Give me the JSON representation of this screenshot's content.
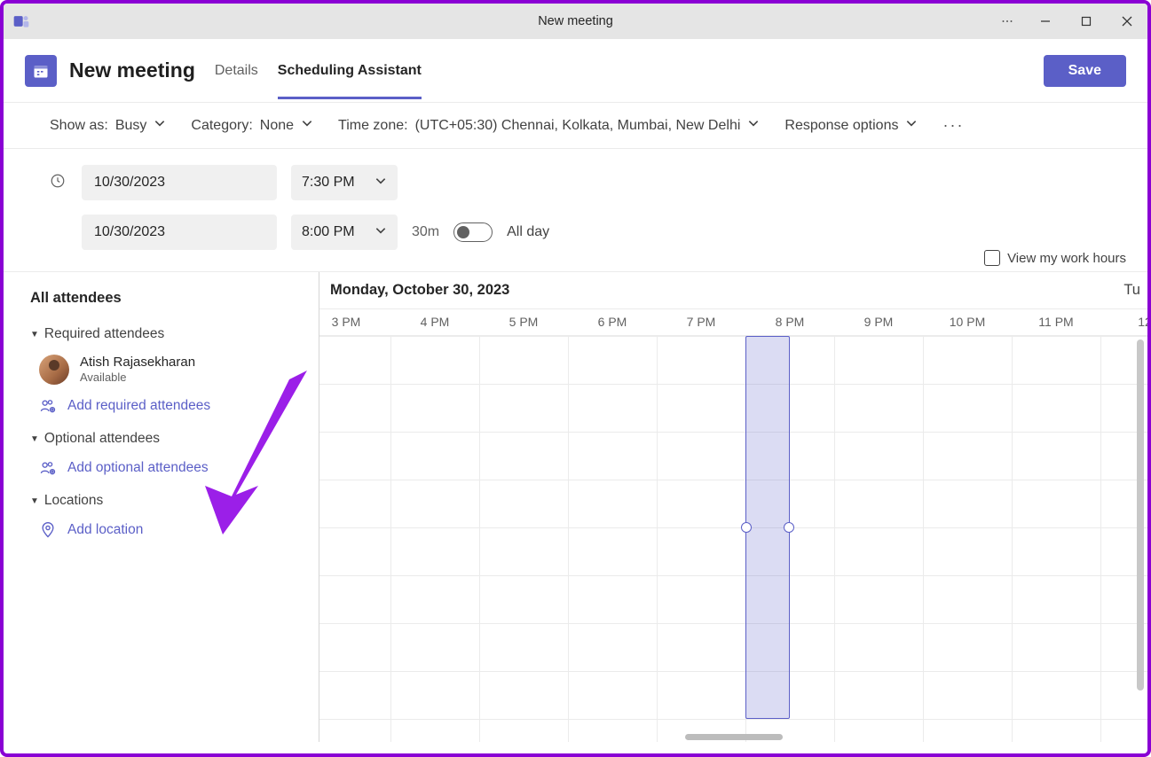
{
  "window": {
    "title": "New meeting"
  },
  "header": {
    "page_title": "New meeting",
    "tabs": {
      "details": "Details",
      "scheduling": "Scheduling Assistant"
    },
    "save": "Save"
  },
  "options": {
    "show_as_label": "Show as:",
    "show_as_value": "Busy",
    "category_label": "Category:",
    "category_value": "None",
    "timezone_label": "Time zone:",
    "timezone_value": "(UTC+05:30) Chennai, Kolkata, Mumbai, New Delhi",
    "response_options": "Response options"
  },
  "datetime": {
    "start_date": "10/30/2023",
    "start_time": "7:30 PM",
    "end_date": "10/30/2023",
    "end_time": "8:00 PM",
    "duration": "30m",
    "all_day": "All day",
    "view_hours": "View my work hours"
  },
  "scheduling": {
    "date_header": "Monday, October 30, 2023",
    "next_day_label": "Tu",
    "last_hour_label": "12",
    "hours": [
      "3 PM",
      "4 PM",
      "5 PM",
      "6 PM",
      "7 PM",
      "8 PM",
      "9 PM",
      "10 PM",
      "11 PM"
    ],
    "selected_start_hour_index": 4.5,
    "selected_end_hour_index": 5.0
  },
  "attendees": {
    "all_label": "All attendees",
    "required_label": "Required attendees",
    "optional_label": "Optional attendees",
    "locations_label": "Locations",
    "required": [
      {
        "name": "Atish Rajasekharan",
        "status": "Available"
      }
    ],
    "add_required": "Add required attendees",
    "add_optional": "Add optional attendees",
    "add_location": "Add location"
  },
  "colors": {
    "accent": "#5b5fc7",
    "annotation": "#8a00d4"
  }
}
